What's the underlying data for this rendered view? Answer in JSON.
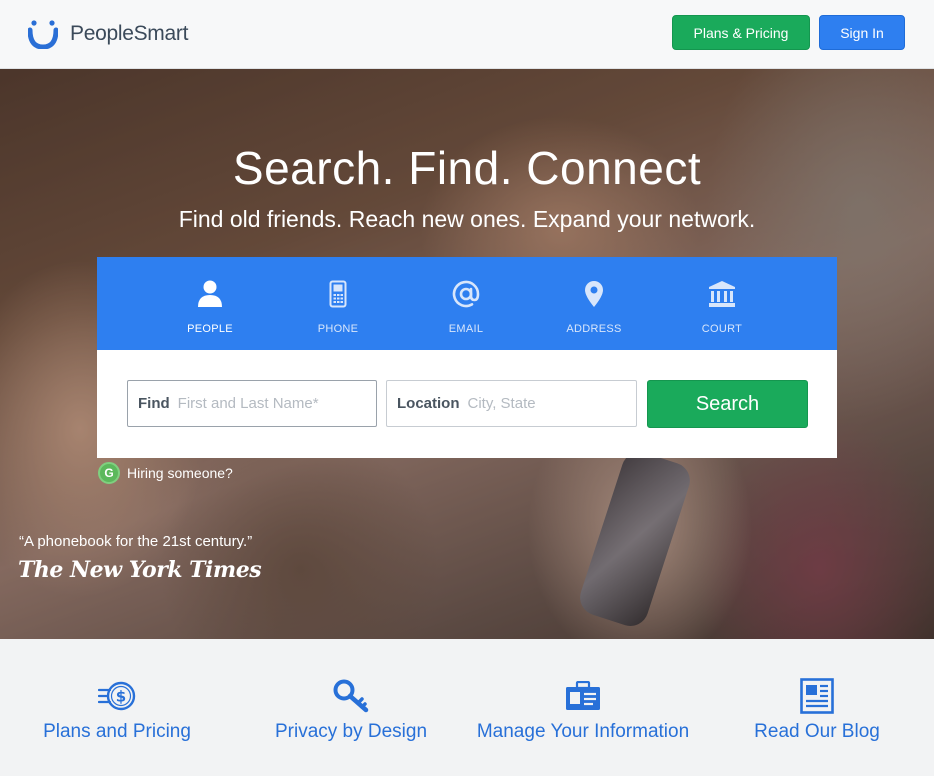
{
  "brand": {
    "name_part1": "People",
    "name_part2": "Smart"
  },
  "header": {
    "pricing_label": "Plans & Pricing",
    "signin_label": "Sign In"
  },
  "hero": {
    "title": "Search. Find. Connect",
    "subtitle": "Find old friends. Reach new ones. Expand your network."
  },
  "tabs": [
    {
      "label": "PEOPLE",
      "icon": "person-icon",
      "active": true
    },
    {
      "label": "PHONE",
      "icon": "phone-icon",
      "active": false
    },
    {
      "label": "EMAIL",
      "icon": "at-icon",
      "active": false
    },
    {
      "label": "ADDRESS",
      "icon": "map-pin-icon",
      "active": false
    },
    {
      "label": "COURT",
      "icon": "courthouse-icon",
      "active": false
    }
  ],
  "search": {
    "find_label": "Find",
    "find_placeholder": "First and Last Name*",
    "location_label": "Location",
    "location_placeholder": "City, State",
    "button_label": "Search"
  },
  "hiring": {
    "badge": "G",
    "label": "Hiring someone?"
  },
  "press": {
    "quote": "“A phonebook for the 21st century.”",
    "source": "The New York Times"
  },
  "features": [
    {
      "label": "Plans and Pricing",
      "icon": "money-icon"
    },
    {
      "label": "Privacy by Design",
      "icon": "key-icon"
    },
    {
      "label": "Manage Your Information",
      "icon": "id-card-icon"
    },
    {
      "label": "Read Our Blog",
      "icon": "newspaper-icon"
    }
  ],
  "colors": {
    "brand_blue": "#2e7ff0",
    "action_green": "#1aaa5b",
    "link_blue": "#2870d8"
  }
}
